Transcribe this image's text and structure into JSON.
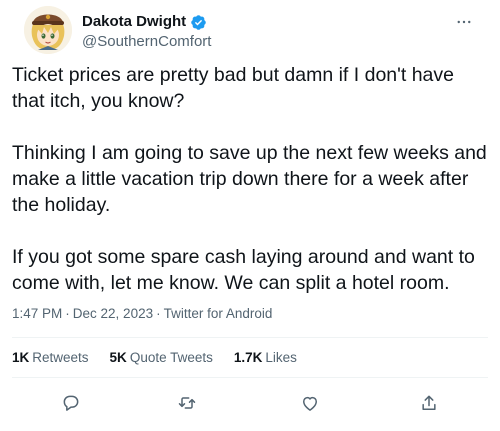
{
  "author": {
    "display_name": "Dakota Dwight",
    "handle": "@SouthernComfort",
    "verified": true,
    "avatar_icon": "anime-character-avatar"
  },
  "tweet": {
    "paragraphs": [
      "Ticket prices are pretty bad but damn if I don't have that itch, you know?",
      "Thinking I am going to save up the next few weeks and make a little vacation trip down there for a week after the holiday.",
      "If you got some spare cash laying around and want to come with, let me know. We can split a hotel room."
    ],
    "time": "1:47 PM",
    "date": "Dec 22, 2023",
    "source": "Twitter for Android",
    "separator": "·"
  },
  "stats": {
    "retweets_count": "1K",
    "retweets_label": "Retweets",
    "quotes_count": "5K",
    "quotes_label": "Quote Tweets",
    "likes_count": "1.7K",
    "likes_label": "Likes"
  },
  "colors": {
    "text": "#0f1419",
    "secondary": "#536471",
    "verified": "#1d9bf0",
    "divider": "#eff3f4"
  },
  "icons": [
    "more-icon",
    "verified-badge-icon",
    "reply-icon",
    "retweet-icon",
    "like-icon",
    "share-icon"
  ]
}
